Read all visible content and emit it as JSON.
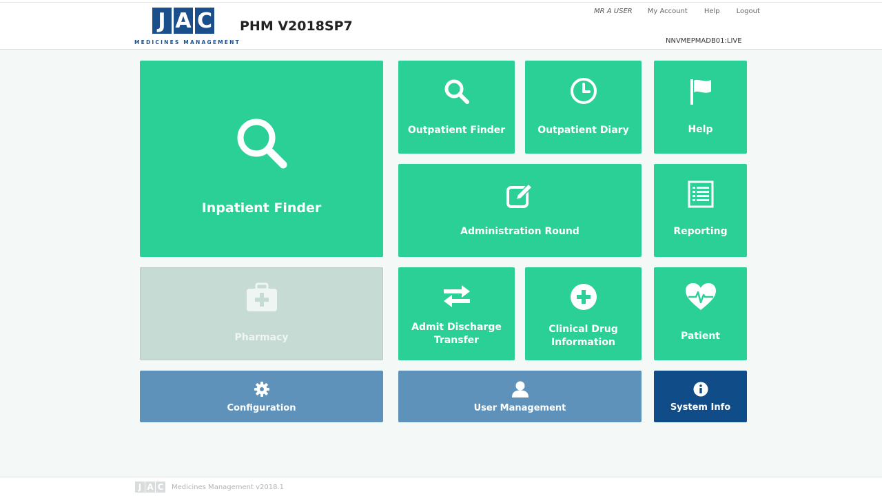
{
  "header": {
    "logo_letters": [
      "J",
      "A",
      "C"
    ],
    "logo_subtitle": "MEDICINES MANAGEMENT",
    "app_title": "PHM V2018SP7",
    "user_name": "MR A USER",
    "nav": {
      "my_account": "My Account",
      "help": "Help",
      "logout": "Logout"
    },
    "server": "NNVMEPMADB01:LIVE"
  },
  "tiles": {
    "inpatient_finder": {
      "label": "Inpatient Finder",
      "icon": "search-icon"
    },
    "outpatient_finder": {
      "label": "Outpatient Finder",
      "icon": "search-icon"
    },
    "outpatient_diary": {
      "label": "Outpatient Diary",
      "icon": "clock-icon"
    },
    "help": {
      "label": "Help",
      "icon": "flag-icon"
    },
    "administration_round": {
      "label": "Administration Round",
      "icon": "edit-icon"
    },
    "reporting": {
      "label": "Reporting",
      "icon": "list-icon"
    },
    "pharmacy": {
      "label": "Pharmacy",
      "icon": "medical-kit-icon",
      "state": "disabled"
    },
    "admit_discharge_transfer": {
      "line1": "Admit Discharge",
      "line2": "Transfer",
      "icon": "exchange-arrows-icon"
    },
    "clinical_drug_information": {
      "line1": "Clinical Drug",
      "line2": "Information",
      "icon": "plus-circle-icon"
    },
    "patient": {
      "label": "Patient",
      "icon": "heartbeat-icon"
    },
    "configuration": {
      "label": "Configuration",
      "icon": "gear-icon"
    },
    "user_management": {
      "label": "User Management",
      "icon": "user-icon"
    },
    "system_info": {
      "label": "System Info",
      "icon": "info-icon"
    }
  },
  "colors": {
    "tile_green": "#2ad096",
    "tile_disabled": "#c5dbd3",
    "tile_blue": "#5f92bb",
    "tile_navy": "#0f4c88",
    "brand_blue": "#1b4f8c"
  },
  "footer": {
    "logo_letters": [
      "J",
      "A",
      "C"
    ],
    "version_text": "Medicines Management v2018.1"
  }
}
